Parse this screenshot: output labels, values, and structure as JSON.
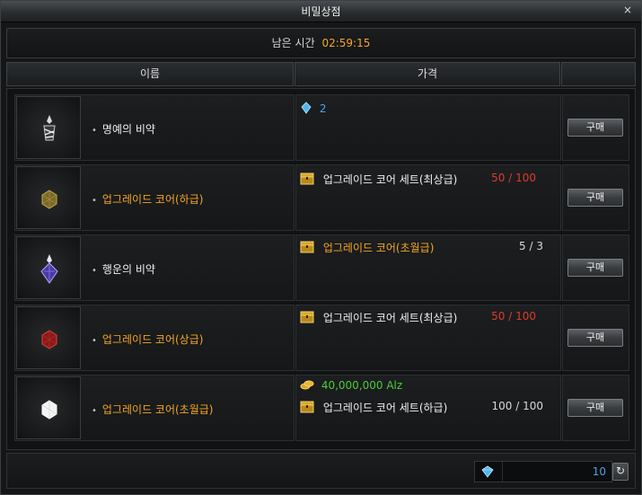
{
  "window": {
    "title": "비밀상점",
    "close_icon": "close-icon"
  },
  "timer": {
    "label": "남은 시간",
    "value": "02:59:15"
  },
  "columns": {
    "name": "이름",
    "price": "가격",
    "buy": ""
  },
  "items": [
    {
      "name": "명예의 비약",
      "name_color": "white",
      "icon": "elixir-honor-icon",
      "prices": [
        {
          "icon": "gem-icon",
          "label": "",
          "count": "2",
          "count_color": "blue"
        }
      ],
      "buy_label": "구매"
    },
    {
      "name": "업그레이드 코어(하급)",
      "name_color": "orange",
      "icon": "upgrade-core-low-icon",
      "prices": [
        {
          "icon": "chest-icon",
          "label": "업그레이드 코어 세트(최상급)",
          "label_color": "white",
          "count": "50 / 100",
          "count_color": "red"
        }
      ],
      "buy_label": "구매"
    },
    {
      "name": "행운의 비약",
      "name_color": "white",
      "icon": "elixir-luck-icon",
      "prices": [
        {
          "icon": "chest-icon",
          "label": "업그레이드 코어(초월급)",
          "label_color": "orange",
          "count": "5 / 3",
          "count_color": "light"
        }
      ],
      "buy_label": "구매"
    },
    {
      "name": "업그레이드 코어(상급)",
      "name_color": "orange",
      "icon": "upgrade-core-high-icon",
      "prices": [
        {
          "icon": "chest-icon",
          "label": "업그레이드 코어 세트(최상급)",
          "label_color": "white",
          "count": "50 / 100",
          "count_color": "red"
        }
      ],
      "buy_label": "구매"
    },
    {
      "name": "업그레이드 코어(초월급)",
      "name_color": "orange",
      "icon": "upgrade-core-transcend-icon",
      "prices": [
        {
          "icon": "alz-coins-icon",
          "label": "",
          "count": "40,000,000 Alz",
          "count_color": "green"
        },
        {
          "icon": "chest-icon",
          "label": "업그레이드 코어 세트(하급)",
          "label_color": "white",
          "count": "100 / 100",
          "count_color": "light"
        }
      ],
      "buy_label": "구매"
    }
  ],
  "footer": {
    "currency_icon": "gem-icon",
    "balance": "10",
    "refresh_icon": "refresh-icon"
  },
  "colors": {
    "accent_orange": "#f5a623",
    "price_red": "#e03a2a",
    "currency_blue": "#4ba3e8",
    "alz_green": "#4ccb3a"
  }
}
